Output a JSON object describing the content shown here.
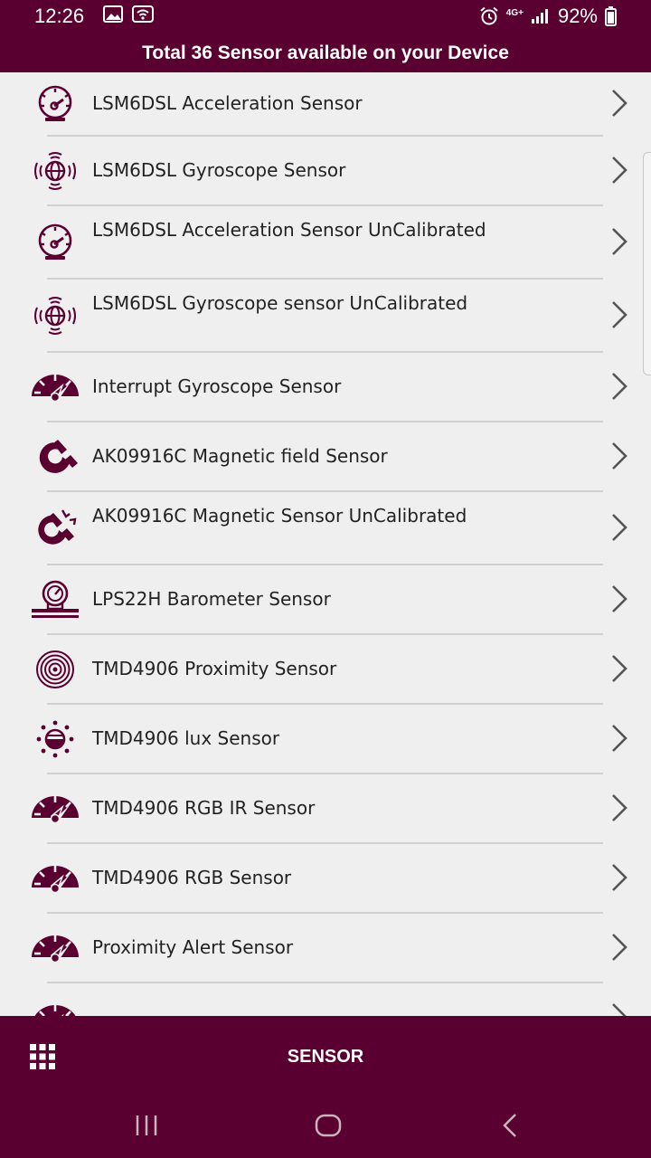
{
  "status_bar": {
    "time": "12:26",
    "network": "4G+",
    "battery": "92%"
  },
  "header": {
    "title": "Total 36 Sensor available on your Device"
  },
  "sensors": [
    {
      "icon": "speedometer-icon",
      "label": "LSM6DSL Acceleration Sensor"
    },
    {
      "icon": "gyroscope-globe-icon",
      "label": "LSM6DSL Gyroscope Sensor"
    },
    {
      "icon": "speedometer-icon",
      "label": "LSM6DSL Acceleration Sensor UnCalibrated"
    },
    {
      "icon": "gyroscope-globe-icon",
      "label": "LSM6DSL Gyroscope sensor UnCalibrated"
    },
    {
      "icon": "gauge-icon",
      "label": "Interrupt Gyroscope Sensor"
    },
    {
      "icon": "magnet-icon",
      "label": "AK09916C Magnetic field Sensor"
    },
    {
      "icon": "magnet-spark-icon",
      "label": "AK09916C Magnetic Sensor UnCalibrated"
    },
    {
      "icon": "barometer-icon",
      "label": "LPS22H Barometer Sensor"
    },
    {
      "icon": "proximity-rings-icon",
      "label": "TMD4906 Proximity Sensor"
    },
    {
      "icon": "lux-sun-icon",
      "label": "TMD4906 lux Sensor"
    },
    {
      "icon": "gauge-icon",
      "label": "TMD4906 RGB IR Sensor"
    },
    {
      "icon": "gauge-icon",
      "label": "TMD4906 RGB Sensor"
    },
    {
      "icon": "gauge-icon",
      "label": "Proximity Alert Sensor"
    },
    {
      "icon": "gauge-icon",
      "label": ""
    }
  ],
  "bottom_bar": {
    "title": "SENSOR"
  },
  "colors": {
    "primary": "#5a0030",
    "background": "#efefef",
    "text": "#222222",
    "divider": "#d0d0d0"
  }
}
